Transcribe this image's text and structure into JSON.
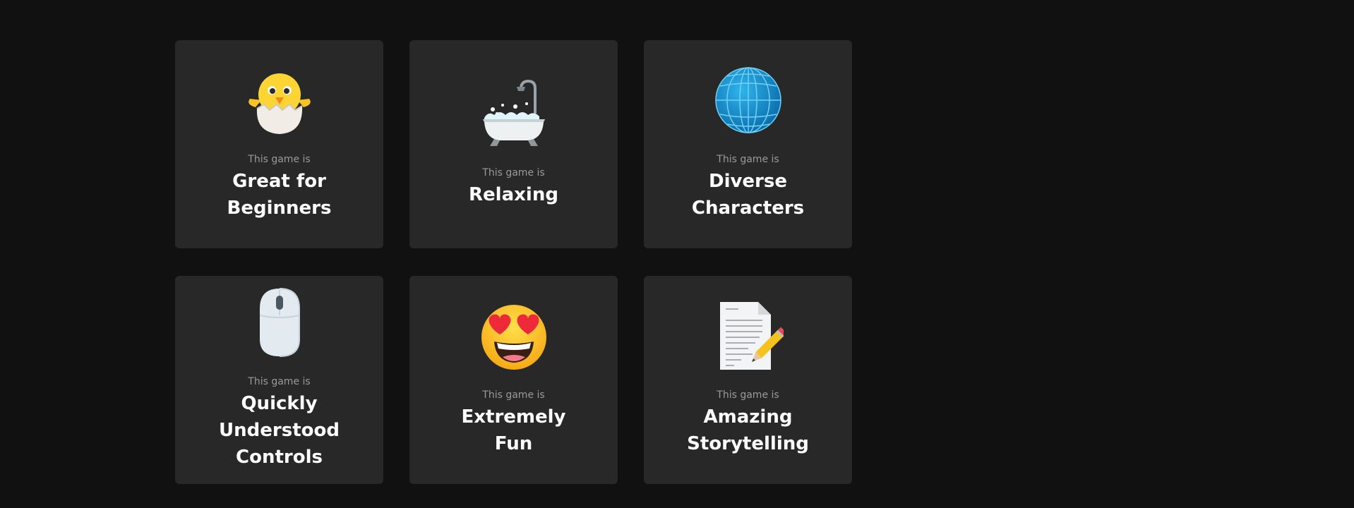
{
  "features": [
    {
      "icon": "hatching-chick-icon",
      "prefix": "This game is",
      "title": "Great for Beginners"
    },
    {
      "icon": "bathtub-icon",
      "prefix": "This game is",
      "title": "Relaxing"
    },
    {
      "icon": "globe-icon",
      "prefix": "This game is",
      "title": "Diverse Characters"
    },
    {
      "icon": "computer-mouse-icon",
      "prefix": "This game is",
      "title": "Quickly Understood Controls"
    },
    {
      "icon": "heart-eyes-face-icon",
      "prefix": "This game is",
      "title": "Extremely Fun"
    },
    {
      "icon": "document-pencil-icon",
      "prefix": "This game is",
      "title": "Amazing Storytelling"
    }
  ],
  "colors": {
    "page_background": "#111111",
    "card_background": "#282828",
    "prefix_text": "#9a9a9a",
    "title_text": "#ffffff"
  }
}
